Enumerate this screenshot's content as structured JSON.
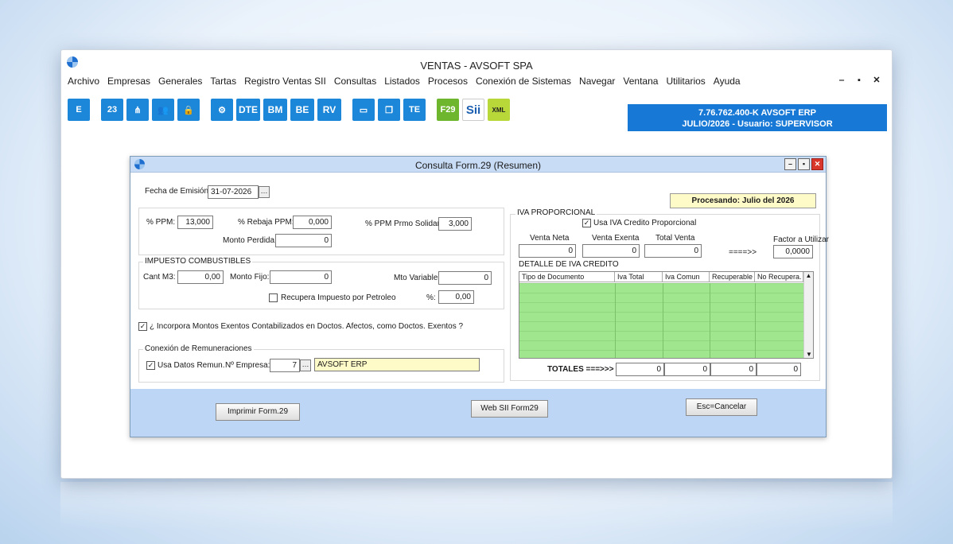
{
  "app": {
    "title": "VENTAS - AVSOFT SPA"
  },
  "menu": [
    "Archivo",
    "Empresas",
    "Generales",
    "Tartas",
    "Registro Ventas SII",
    "Consultas",
    "Listados",
    "Procesos",
    "Conexión de Sistemas",
    "Navegar",
    "Ventana",
    "Utilitarios",
    "Ayuda"
  ],
  "toolbar": {
    "buttons": [
      {
        "label": "E",
        "icon": "e-icon"
      },
      {
        "label": "23",
        "icon": "calendar-icon"
      },
      {
        "label": "⋔",
        "icon": "share-icon"
      },
      {
        "label": "👥",
        "icon": "users-icon"
      },
      {
        "label": "🔒",
        "icon": "lock-icon"
      },
      {
        "label": "⚙",
        "icon": "gear-icon"
      },
      {
        "label": "DTE",
        "icon": "dte-icon"
      },
      {
        "label": "BM",
        "icon": "bm-icon"
      },
      {
        "label": "BE",
        "icon": "be-icon"
      },
      {
        "label": "RV",
        "icon": "rv-icon"
      },
      {
        "label": "▭",
        "icon": "window-icon"
      },
      {
        "label": "❐",
        "icon": "windows-icon"
      },
      {
        "label": "TE",
        "icon": "te-icon"
      },
      {
        "label": "F29",
        "icon": "f29-icon"
      },
      {
        "label": "Sii",
        "icon": "sii-icon"
      },
      {
        "label": "XML",
        "icon": "xml-icon"
      }
    ]
  },
  "company": {
    "line1": "7.76.762.400-K AVSOFT ERP",
    "line2": "JULIO/2026  -  Usuario: SUPERVISOR"
  },
  "dialog": {
    "title": "Consulta Form.29 (Resumen)",
    "fecha_label": "Fecha de Emisión:",
    "fecha_value": "31-07-2026",
    "status": "Procesando: Julio del 2026",
    "ppm_label": "% PPM:",
    "ppm_value": "13,000",
    "rebaja_label": "% Rebaja PPM:",
    "rebaja_value": "0,000",
    "ppm_solidario_label": "% PPM Prmo Solidario:",
    "ppm_solidario_value": "3,000",
    "monto_perdida_label": "Monto Perdida:",
    "monto_perdida_value": "0",
    "combustibles": {
      "title": "IMPUESTO COMBUSTIBLES",
      "cant_label": "Cant M3:",
      "cant_value": "0,00",
      "fijo_label": "Monto Fijo:",
      "fijo_value": "0",
      "variable_label": "Mto Variable:",
      "variable_value": "0",
      "recupera_label": "Recupera Impuesto por Petroleo",
      "pct_label": "%:",
      "pct_value": "0,00"
    },
    "incorpora_label": "¿ Incorpora Montos Exentos Contabilizados en Doctos. Afectos, como Doctos. Exentos ?",
    "remuneraciones": {
      "title": "Conexión de Remuneraciones",
      "usa_label": "Usa Datos Remun.",
      "empresa_label": "Nº Empresa:",
      "empresa_value": "7",
      "empresa_name": "AVSOFT ERP"
    },
    "iva": {
      "title": "IVA PROPORCIONAL",
      "usa_label": "Usa IVA Credito Proporcional",
      "venta_neta_label": "Venta Neta",
      "venta_neta_value": "0",
      "venta_exenta_label": "Venta Exenta",
      "venta_exenta_value": "0",
      "total_venta_label": "Total Venta",
      "total_venta_value": "0",
      "arrow": "====>>",
      "factor_label": "Factor a Utilizar",
      "factor_value": "0,0000",
      "detalle_title": "DETALLE DE IVA CREDITO",
      "columns": [
        "Tipo de Documento",
        "Iva Total",
        "Iva Comun",
        "Recuperable",
        "No Recupera."
      ],
      "totales_label": "TOTALES ===>>>",
      "totales": [
        "0",
        "0",
        "0",
        "0"
      ]
    },
    "buttons": {
      "imprimir": "Imprimir Form.29",
      "web": "Web SII Form29",
      "cancelar": "Esc=Cancelar"
    }
  }
}
